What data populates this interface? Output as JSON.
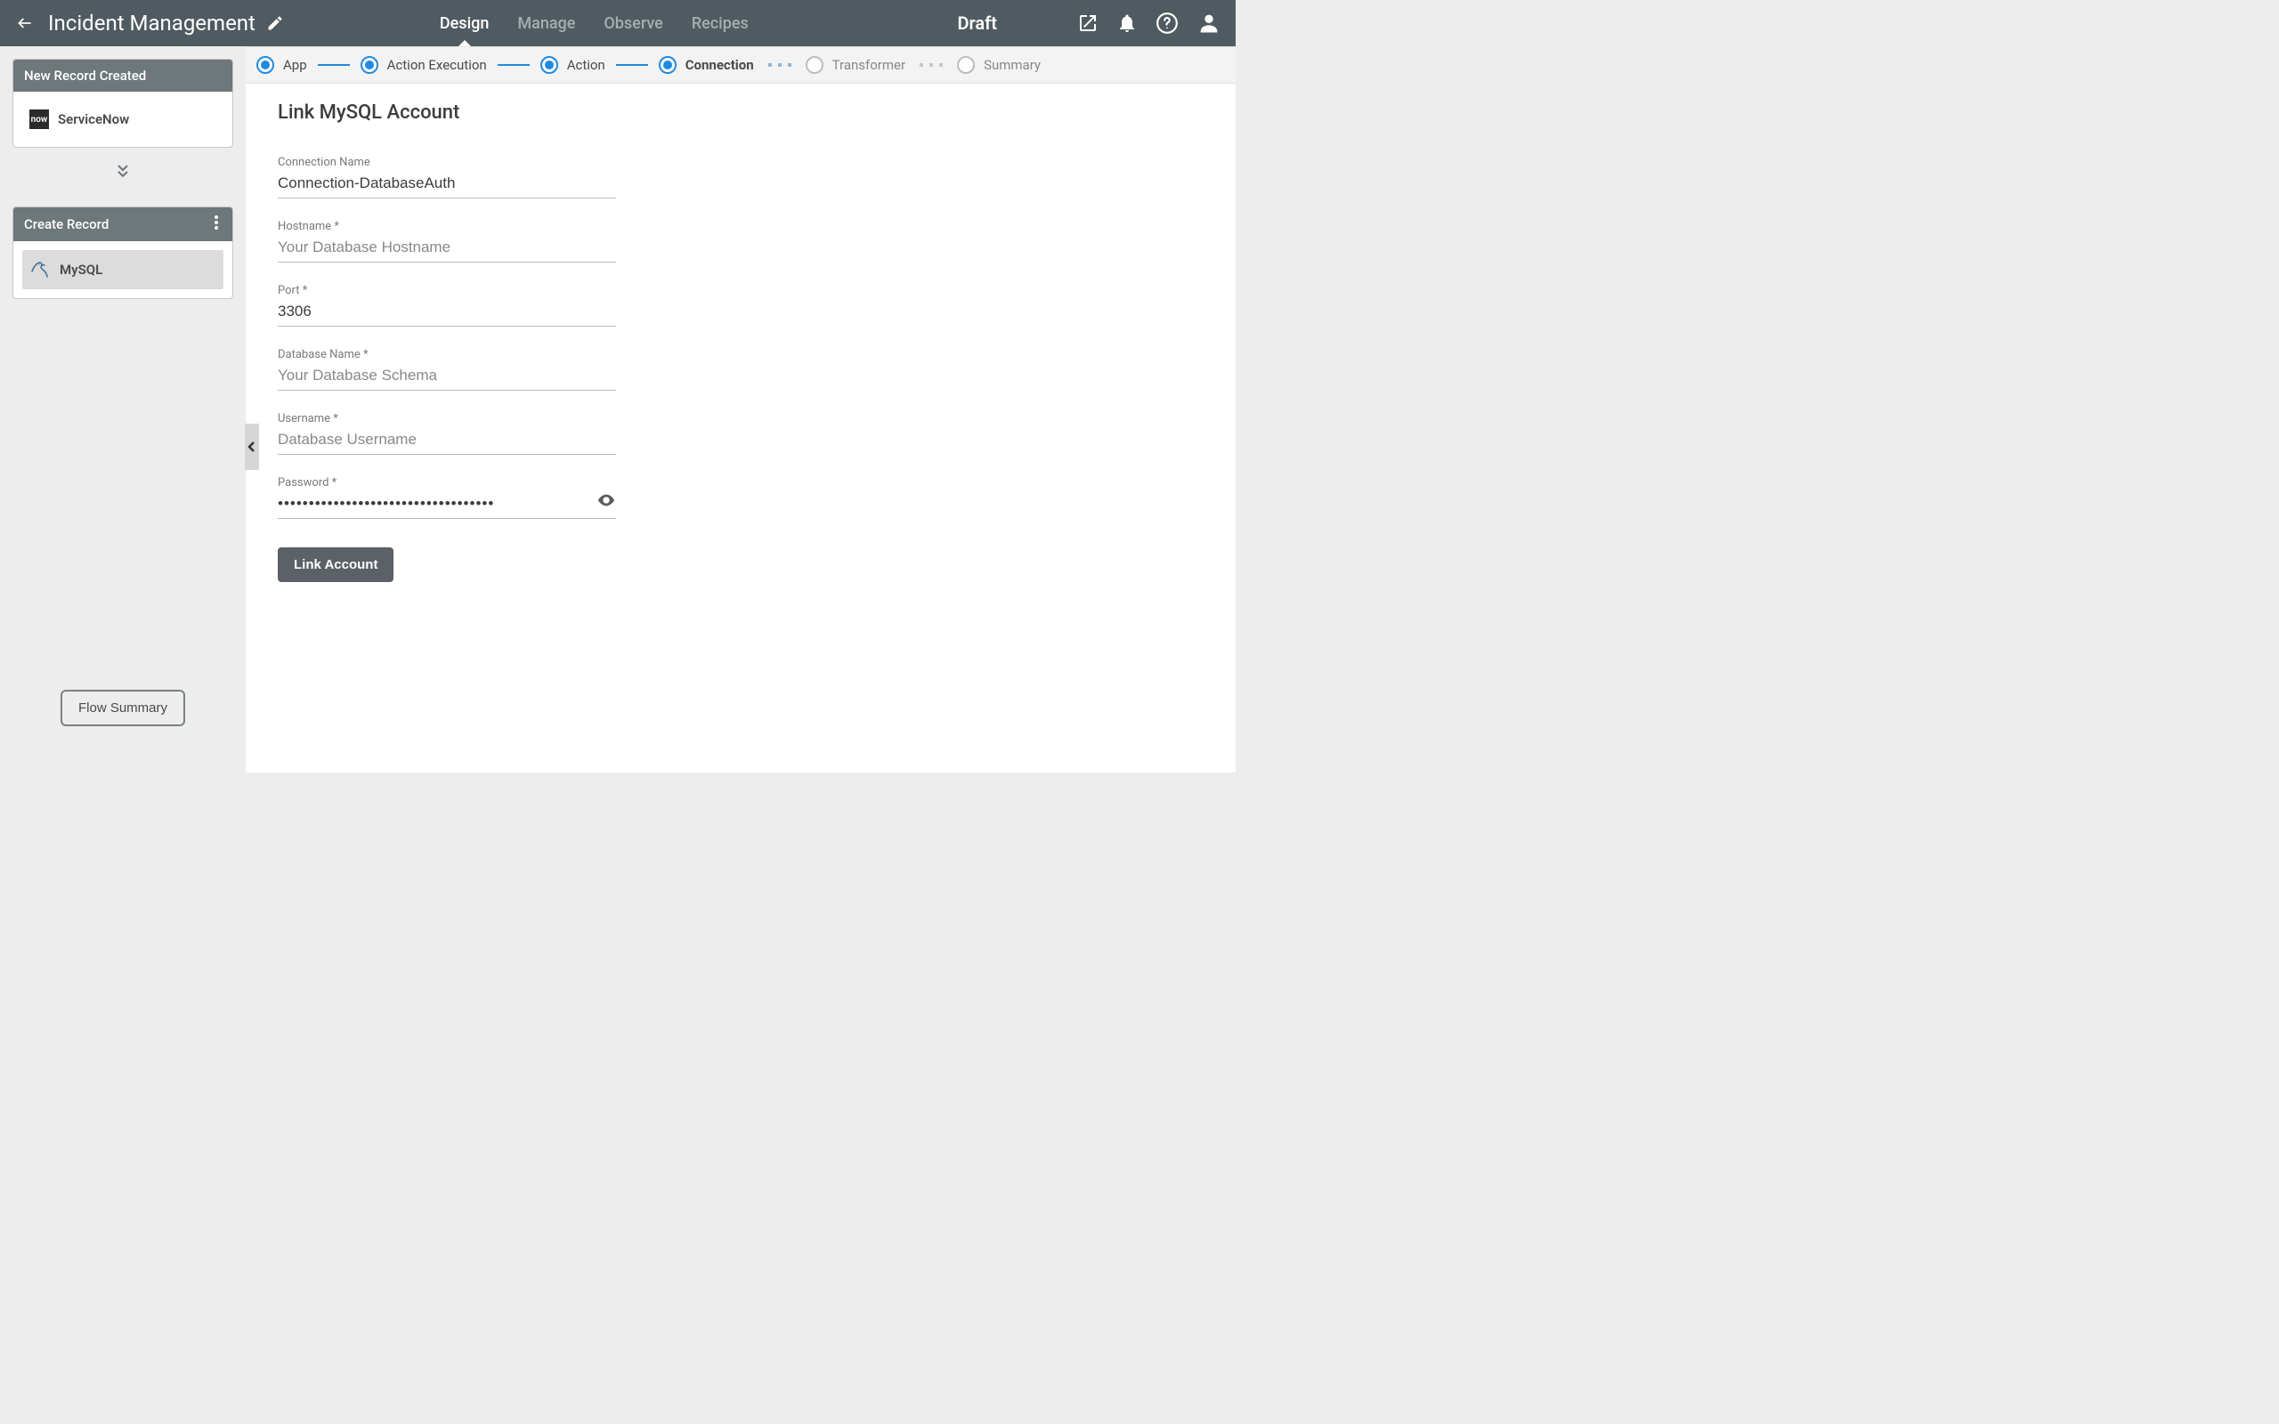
{
  "header": {
    "title": "Incident Management",
    "draft_label": "Draft",
    "tabs": [
      {
        "label": "Design",
        "active": true
      },
      {
        "label": "Manage",
        "active": false
      },
      {
        "label": "Observe",
        "active": false
      },
      {
        "label": "Recipes",
        "active": false
      }
    ]
  },
  "sidebar": {
    "card1_title": "New Record Created",
    "card1_item": "ServiceNow",
    "card2_title": "Create Record",
    "card2_item": "MySQL",
    "flow_summary": "Flow Summary"
  },
  "steps": [
    {
      "label": "App",
      "state": "filled"
    },
    {
      "label": "Action Execution",
      "state": "filled"
    },
    {
      "label": "Action",
      "state": "filled"
    },
    {
      "label": "Connection",
      "state": "filled",
      "current": true
    },
    {
      "label": "Transformer",
      "state": "empty"
    },
    {
      "label": "Summary",
      "state": "empty"
    }
  ],
  "form": {
    "title": "Link MySQL Account",
    "connection_name_label": "Connection Name",
    "connection_name_value": "Connection-DatabaseAuth",
    "hostname_label": "Hostname *",
    "hostname_placeholder": "Your Database Hostname",
    "port_label": "Port *",
    "port_value": "3306",
    "database_label": "Database Name *",
    "database_placeholder": "Your Database Schema",
    "username_label": "Username *",
    "username_placeholder": "Database Username",
    "password_label": "Password *",
    "password_value": "•••••••••••••••••••••••••••••••••••",
    "submit_label": "Link Account"
  }
}
